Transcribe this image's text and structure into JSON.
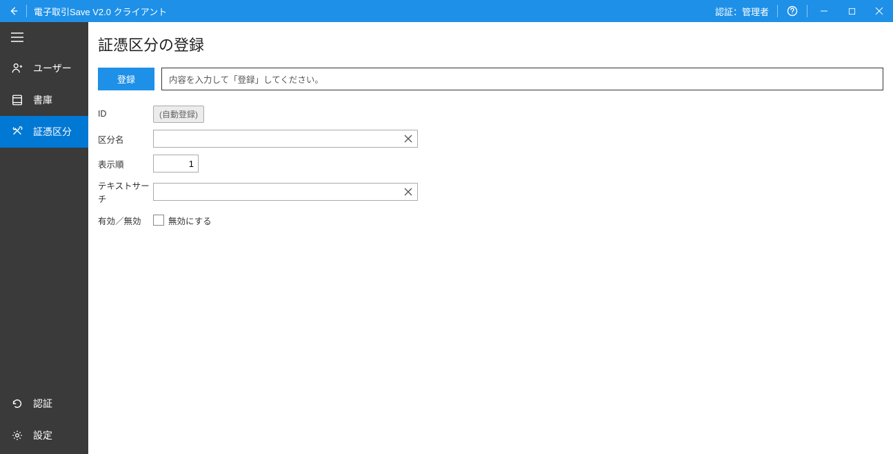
{
  "titlebar": {
    "app_title": "電子取引Save V2.0 クライアント",
    "auth_label": "認証：管理者"
  },
  "sidebar": {
    "items_top": [
      {
        "label": "ユーザー",
        "icon": "user-icon",
        "active": false
      },
      {
        "label": "書庫",
        "icon": "book-icon",
        "active": false
      },
      {
        "label": "証憑区分",
        "icon": "tools-icon",
        "active": true
      }
    ],
    "items_bottom": [
      {
        "label": "認証",
        "icon": "refresh-icon"
      },
      {
        "label": "設定",
        "icon": "gear-icon"
      }
    ]
  },
  "main": {
    "page_title": "証憑区分の登録",
    "register_button": "登録",
    "message": "内容を入力して「登録」してください。",
    "form": {
      "id_label": "ID",
      "id_badge": "(自動登録)",
      "name_label": "区分名",
      "name_value": "",
      "order_label": "表示順",
      "order_value": "1",
      "text_search_label": "テキストサーチ",
      "text_search_value": "",
      "enabled_label": "有効／無効",
      "disable_checkbox_label": "無効にする"
    }
  }
}
